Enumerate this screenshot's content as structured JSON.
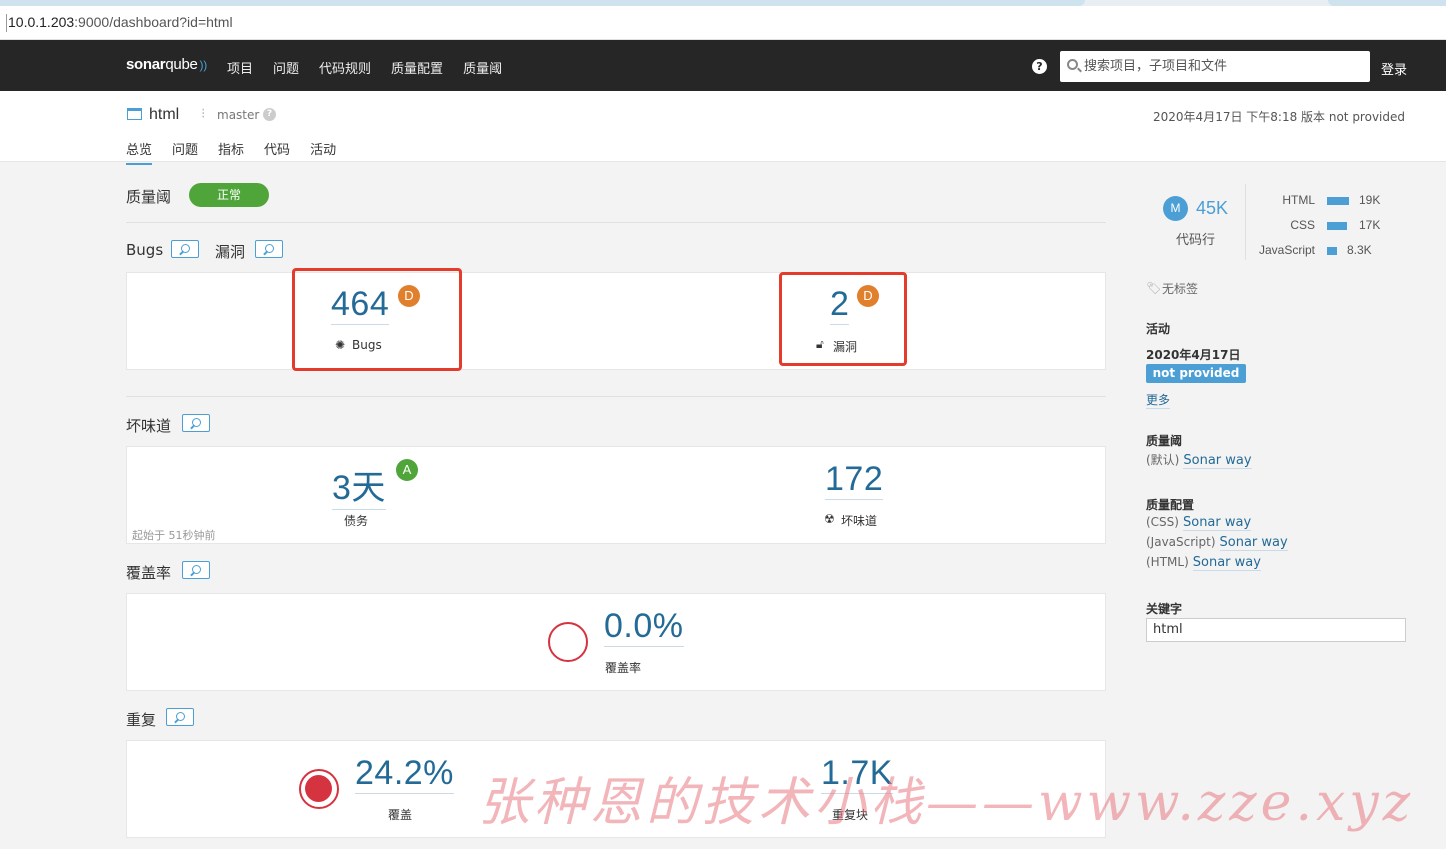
{
  "browser": {
    "url_host": "10.0.1.203",
    "url_path": ":9000/dashboard?id=html"
  },
  "nav": {
    "logo_a": "sonar",
    "logo_b": "qube",
    "links": [
      "项目",
      "问题",
      "代码规则",
      "质量配置",
      "质量阈"
    ],
    "search_placeholder": "搜索项目，子项目和文件",
    "login": "登录"
  },
  "project": {
    "name": "html",
    "branch": "master",
    "meta": "2020年4月17日 下午8:18   版本 not provided",
    "tabs": [
      "总览",
      "问题",
      "指标",
      "代码",
      "活动"
    ]
  },
  "quality_gate": {
    "title": "质量阈",
    "status": "正常"
  },
  "bugs_section": {
    "title_bugs": "Bugs",
    "title_vuln": "漏洞",
    "bugs_value": "464",
    "bugs_rating": "D",
    "bugs_label": "Bugs",
    "vuln_value": "2",
    "vuln_rating": "D",
    "vuln_label": "漏洞"
  },
  "smells_section": {
    "title": "坏味道",
    "debt_value": "3天",
    "debt_rating": "A",
    "debt_label": "债务",
    "smells_value": "172",
    "smells_label": "坏味道",
    "since": "起始于 51秒钟前"
  },
  "coverage_section": {
    "title": "覆盖率",
    "value": "0.0%",
    "label": "覆盖率"
  },
  "dup_section": {
    "title": "重复",
    "value": "24.2%",
    "label": "覆盖",
    "blocks_value": "1.7K",
    "blocks_label": "重复块"
  },
  "sidebar": {
    "loc_badge": "M",
    "loc_value": "45K",
    "loc_label": "代码行",
    "languages": [
      {
        "name": "HTML",
        "value": "19K",
        "fraction": 1.0
      },
      {
        "name": "CSS",
        "value": "17K",
        "fraction": 0.9
      },
      {
        "name": "JavaScript",
        "value": "8.3K",
        "fraction": 0.44
      }
    ],
    "tags": "无标签",
    "activity_title": "活动",
    "activity_date": "2020年4月17日",
    "activity_version": "not provided",
    "more": "更多",
    "qg_title": "质量阈",
    "qg_prefix": "(默认)",
    "qg_link": "Sonar way",
    "qp_title": "质量配置",
    "qp_rows": [
      {
        "prefix": "(CSS)",
        "link": "Sonar way"
      },
      {
        "prefix": "(JavaScript)",
        "link": "Sonar way"
      },
      {
        "prefix": "(HTML)",
        "link": "Sonar way"
      }
    ],
    "kw_title": "关键字",
    "kw_value": "html"
  },
  "watermark": "张种恩的技术小栈——www.zze.xyz",
  "colors": {
    "accent": "#4b9fd5",
    "value_blue": "#236a97",
    "ok_green": "#4fa53a",
    "rating_d": "#e07f2c",
    "error_red": "#d4333f",
    "highlight_red": "#e33b2c"
  }
}
